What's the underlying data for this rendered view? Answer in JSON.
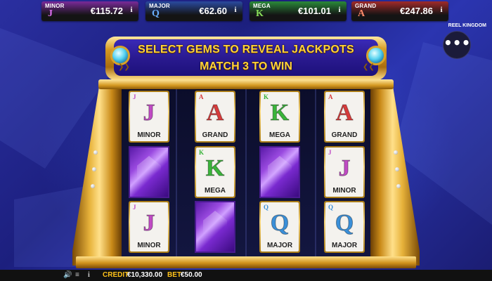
{
  "jackpots": [
    {
      "tag": "MINOR",
      "glyph": "J",
      "amount": "€115.72",
      "info": "i",
      "bg": "#7a2a9a",
      "glyph_color": "#e070f0"
    },
    {
      "tag": "MAJOR",
      "glyph": "Q",
      "amount": "€62.60",
      "info": "i",
      "bg": "#2a4aa0",
      "glyph_color": "#6ab0ff"
    },
    {
      "tag": "MEGA",
      "glyph": "K",
      "amount": "€101.01",
      "info": "i",
      "bg": "#2a8a3a",
      "glyph_color": "#8ae05a"
    },
    {
      "tag": "GRAND",
      "glyph": "A",
      "amount": "€247.86",
      "info": "i",
      "bg": "#a02a2a",
      "glyph_color": "#ff8a6a"
    }
  ],
  "brand": "REEL KINGDOM",
  "menu_icon": "•••",
  "banner": {
    "line1": "SELECT GEMS TO REVEAL JACKPOTS",
    "line2": "MATCH 3 TO WIN"
  },
  "grid": [
    [
      {
        "type": "card",
        "glyph": "J",
        "label": "MINOR",
        "cls": "c-minor"
      },
      {
        "type": "card",
        "glyph": "A",
        "label": "GRAND",
        "cls": "c-grand"
      },
      {
        "type": "card",
        "glyph": "K",
        "label": "MEGA",
        "cls": "c-mega"
      },
      {
        "type": "card",
        "glyph": "A",
        "label": "GRAND",
        "cls": "c-grand"
      }
    ],
    [
      {
        "type": "gem"
      },
      {
        "type": "card",
        "glyph": "K",
        "label": "MEGA",
        "cls": "c-mega"
      },
      {
        "type": "gem"
      },
      {
        "type": "card",
        "glyph": "J",
        "label": "MINOR",
        "cls": "c-minor"
      }
    ],
    [
      {
        "type": "card",
        "glyph": "J",
        "label": "MINOR",
        "cls": "c-minor"
      },
      {
        "type": "gem"
      },
      {
        "type": "card",
        "glyph": "Q",
        "label": "MAJOR",
        "cls": "c-major"
      },
      {
        "type": "card",
        "glyph": "Q",
        "label": "MAJOR",
        "cls": "c-major"
      }
    ]
  ],
  "bottom": {
    "sound_icon": "🔊",
    "menu_icon": "≡",
    "info_icon": "i",
    "credit_label": "CREDIT",
    "credit_value": "€10,330.00",
    "bet_label": "BET",
    "bet_value": "€50.00"
  }
}
